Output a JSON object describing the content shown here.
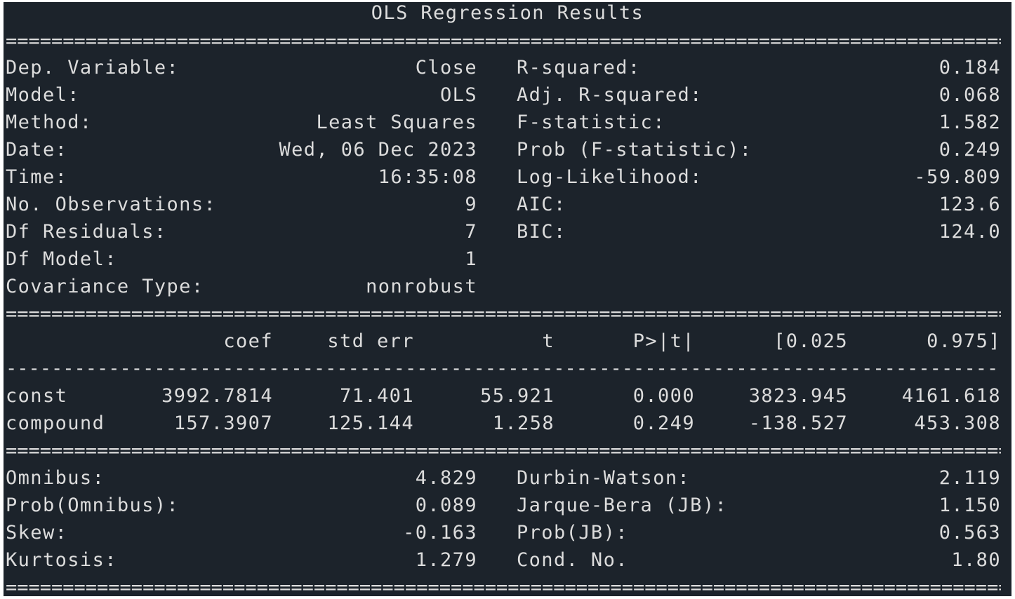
{
  "title": "OLS Regression Results",
  "rule_double": "====================================================================================================",
  "rule_single": "----------------------------------------------------------------------------------------------------",
  "model_info": [
    {
      "label": "Dep. Variable:",
      "value": "Close",
      "stat_label": "R-squared:",
      "stat_value": "0.184"
    },
    {
      "label": "Model:",
      "value": "OLS",
      "stat_label": "Adj. R-squared:",
      "stat_value": "0.068"
    },
    {
      "label": "Method:",
      "value": "Least Squares",
      "stat_label": "F-statistic:",
      "stat_value": "1.582"
    },
    {
      "label": "Date:",
      "value": "Wed, 06 Dec 2023",
      "stat_label": "Prob (F-statistic):",
      "stat_value": "0.249"
    },
    {
      "label": "Time:",
      "value": "16:35:08",
      "stat_label": "Log-Likelihood:",
      "stat_value": "-59.809"
    },
    {
      "label": "No. Observations:",
      "value": "9",
      "stat_label": "AIC:",
      "stat_value": "123.6"
    },
    {
      "label": "Df Residuals:",
      "value": "7",
      "stat_label": "BIC:",
      "stat_value": "124.0"
    },
    {
      "label": "Df Model:",
      "value": "1",
      "stat_label": "",
      "stat_value": ""
    },
    {
      "label": "Covariance Type:",
      "value": "nonrobust",
      "stat_label": "",
      "stat_value": ""
    }
  ],
  "coef_table": {
    "headers": [
      "coef",
      "std err",
      "t",
      "P>|t|",
      "[0.025",
      "0.975]"
    ],
    "rows": [
      {
        "name": "const",
        "values": [
          "3992.7814",
          "71.401",
          "55.921",
          "0.000",
          "3823.945",
          "4161.618"
        ]
      },
      {
        "name": "compound",
        "values": [
          "157.3907",
          "125.144",
          "1.258",
          "0.249",
          "-138.527",
          "453.308"
        ]
      }
    ]
  },
  "diagnostics": [
    {
      "label": "Omnibus:",
      "value": "4.829",
      "stat_label": "Durbin-Watson:",
      "stat_value": "2.119"
    },
    {
      "label": "Prob(Omnibus):",
      "value": "0.089",
      "stat_label": "Jarque-Bera (JB):",
      "stat_value": "1.150"
    },
    {
      "label": "Skew:",
      "value": "-0.163",
      "stat_label": "Prob(JB):",
      "stat_value": "0.563"
    },
    {
      "label": "Kurtosis:",
      "value": "1.279",
      "stat_label": "Cond. No.",
      "stat_value": "1.80"
    }
  ],
  "colors": {
    "background": "#1c232b",
    "text": "#dcdcdc",
    "page": "#ffffff"
  }
}
